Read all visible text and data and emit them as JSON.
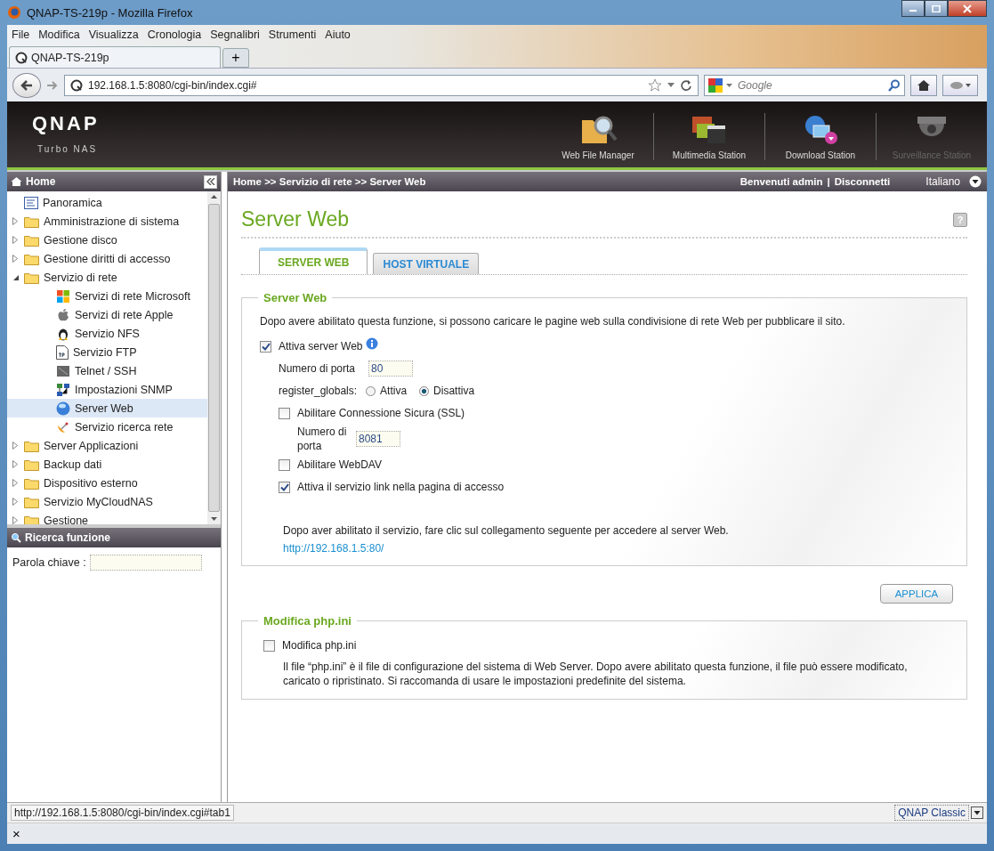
{
  "window": {
    "title": "QNAP-TS-219p - Mozilla Firefox"
  },
  "menu": [
    "File",
    "Modifica",
    "Visualizza",
    "Cronologia",
    "Segnalibri",
    "Strumenti",
    "Aiuto"
  ],
  "browser_tabs": [
    {
      "label": "QNAP-TS-219p",
      "selected": true
    }
  ],
  "new_tab": "+",
  "address": {
    "url": "192.168.1.5:8080/cgi-bin/index.cgi#"
  },
  "search": {
    "placeholder": "Google"
  },
  "header": {
    "logo": "QNAP",
    "subtitle": "Turbo NAS",
    "apps": [
      {
        "label": "Web File Manager",
        "kind": "files",
        "disabled": false
      },
      {
        "label": "Multimedia Station",
        "kind": "media",
        "disabled": false
      },
      {
        "label": "Download Station",
        "kind": "download",
        "disabled": false
      },
      {
        "label": "Surveillance Station",
        "kind": "camera",
        "disabled": true
      }
    ]
  },
  "sidebar": {
    "title": "Home",
    "tree": [
      {
        "label": "Panoramica",
        "kind": "overview"
      },
      {
        "label": "Amministrazione di sistema",
        "kind": "folder",
        "expanded": false
      },
      {
        "label": "Gestione disco",
        "kind": "folder",
        "expanded": false
      },
      {
        "label": "Gestione diritti di accesso",
        "kind": "folder",
        "expanded": false
      },
      {
        "label": "Servizio di rete",
        "kind": "folder",
        "expanded": true,
        "children": [
          {
            "label": "Servizi di rete Microsoft",
            "kind": "windows",
            "selected": false
          },
          {
            "label": "Servizi di rete Apple",
            "kind": "apple",
            "selected": false
          },
          {
            "label": "Servizio NFS",
            "kind": "penguin",
            "selected": false
          },
          {
            "label": "Servizio FTP",
            "kind": "ftp",
            "selected": false
          },
          {
            "label": "Telnet / SSH",
            "kind": "terminal",
            "selected": false
          },
          {
            "label": "Impostazioni SNMP",
            "kind": "network",
            "selected": false
          },
          {
            "label": "Server Web",
            "kind": "globe",
            "selected": true
          },
          {
            "label": "Servizio ricerca rete",
            "kind": "satellite",
            "selected": false
          }
        ]
      },
      {
        "label": "Server Applicazioni",
        "kind": "folder",
        "expanded": false
      },
      {
        "label": "Backup dati",
        "kind": "folder",
        "expanded": false
      },
      {
        "label": "Dispositivo esterno",
        "kind": "folder",
        "expanded": false
      },
      {
        "label": "Servizio MyCloudNAS",
        "kind": "folder",
        "expanded": false
      },
      {
        "label": "Gestione",
        "kind": "folder",
        "expanded": false
      }
    ],
    "search_panel": {
      "title": "Ricerca funzione",
      "label": "Parola chiave :"
    }
  },
  "topbar": {
    "breadcrumb": "Home >> Servizio di rete >> Server Web",
    "welcome": "Benvenuti admin",
    "separator": "|",
    "logout": "Disconnetti",
    "language": "Italiano"
  },
  "page": {
    "title": "Server Web",
    "help": "?",
    "tabs": [
      {
        "label": "SERVER WEB",
        "selected": true
      },
      {
        "label": "HOST VIRTUALE",
        "selected": false
      }
    ],
    "web_section": {
      "legend": "Server Web",
      "description": "Dopo avere abilitato questa funzione, si possono caricare le pagine web sulla condivisione di rete Web per pubblicare il sito.",
      "options": [
        {
          "kind": "checkbox",
          "label": "Attiva server Web",
          "checked": true,
          "info": true,
          "children": [
            {
              "kind": "input",
              "label": "Numero di porta",
              "value": "80"
            },
            {
              "kind": "radio",
              "label": "register_globals:",
              "options": [
                {
                  "label": "Attiva",
                  "selected": false
                },
                {
                  "label": "Disattiva",
                  "selected": true
                }
              ]
            },
            {
              "kind": "checkbox",
              "label": "Abilitare Connessione Sicura (SSL)",
              "checked": false,
              "children": [
                {
                  "kind": "input",
                  "label": "Numero di porta",
                  "value": "8081"
                }
              ]
            },
            {
              "kind": "checkbox",
              "label": "Abilitare WebDAV",
              "checked": false
            },
            {
              "kind": "checkbox",
              "label": "Attiva il servizio link nella pagina di accesso",
              "checked": true
            }
          ]
        }
      ],
      "note": "Dopo aver abilitato il servizio, fare clic sul collegamento seguente per accedere al server Web.",
      "link": "http://192.168.1.5:80/"
    },
    "apply_button": "APPLICA",
    "php_section": {
      "legend": "Modifica php.ini",
      "option": {
        "label": "Modifica php.ini",
        "checked": false
      },
      "description": "Il file “php.ini” è il file di configurazione del sistema di Web Server. Dopo avere abilitato questa funzione, il file può essere modificato, caricato o ripristinato. Si raccomanda di usare le impostazioni predefinite del sistema."
    }
  },
  "status_bar": {
    "url": "http://192.168.1.5:8080/cgi-bin/index.cgi#tab1",
    "theme": "QNAP Classic"
  },
  "find_bar": {
    "close": "×"
  }
}
